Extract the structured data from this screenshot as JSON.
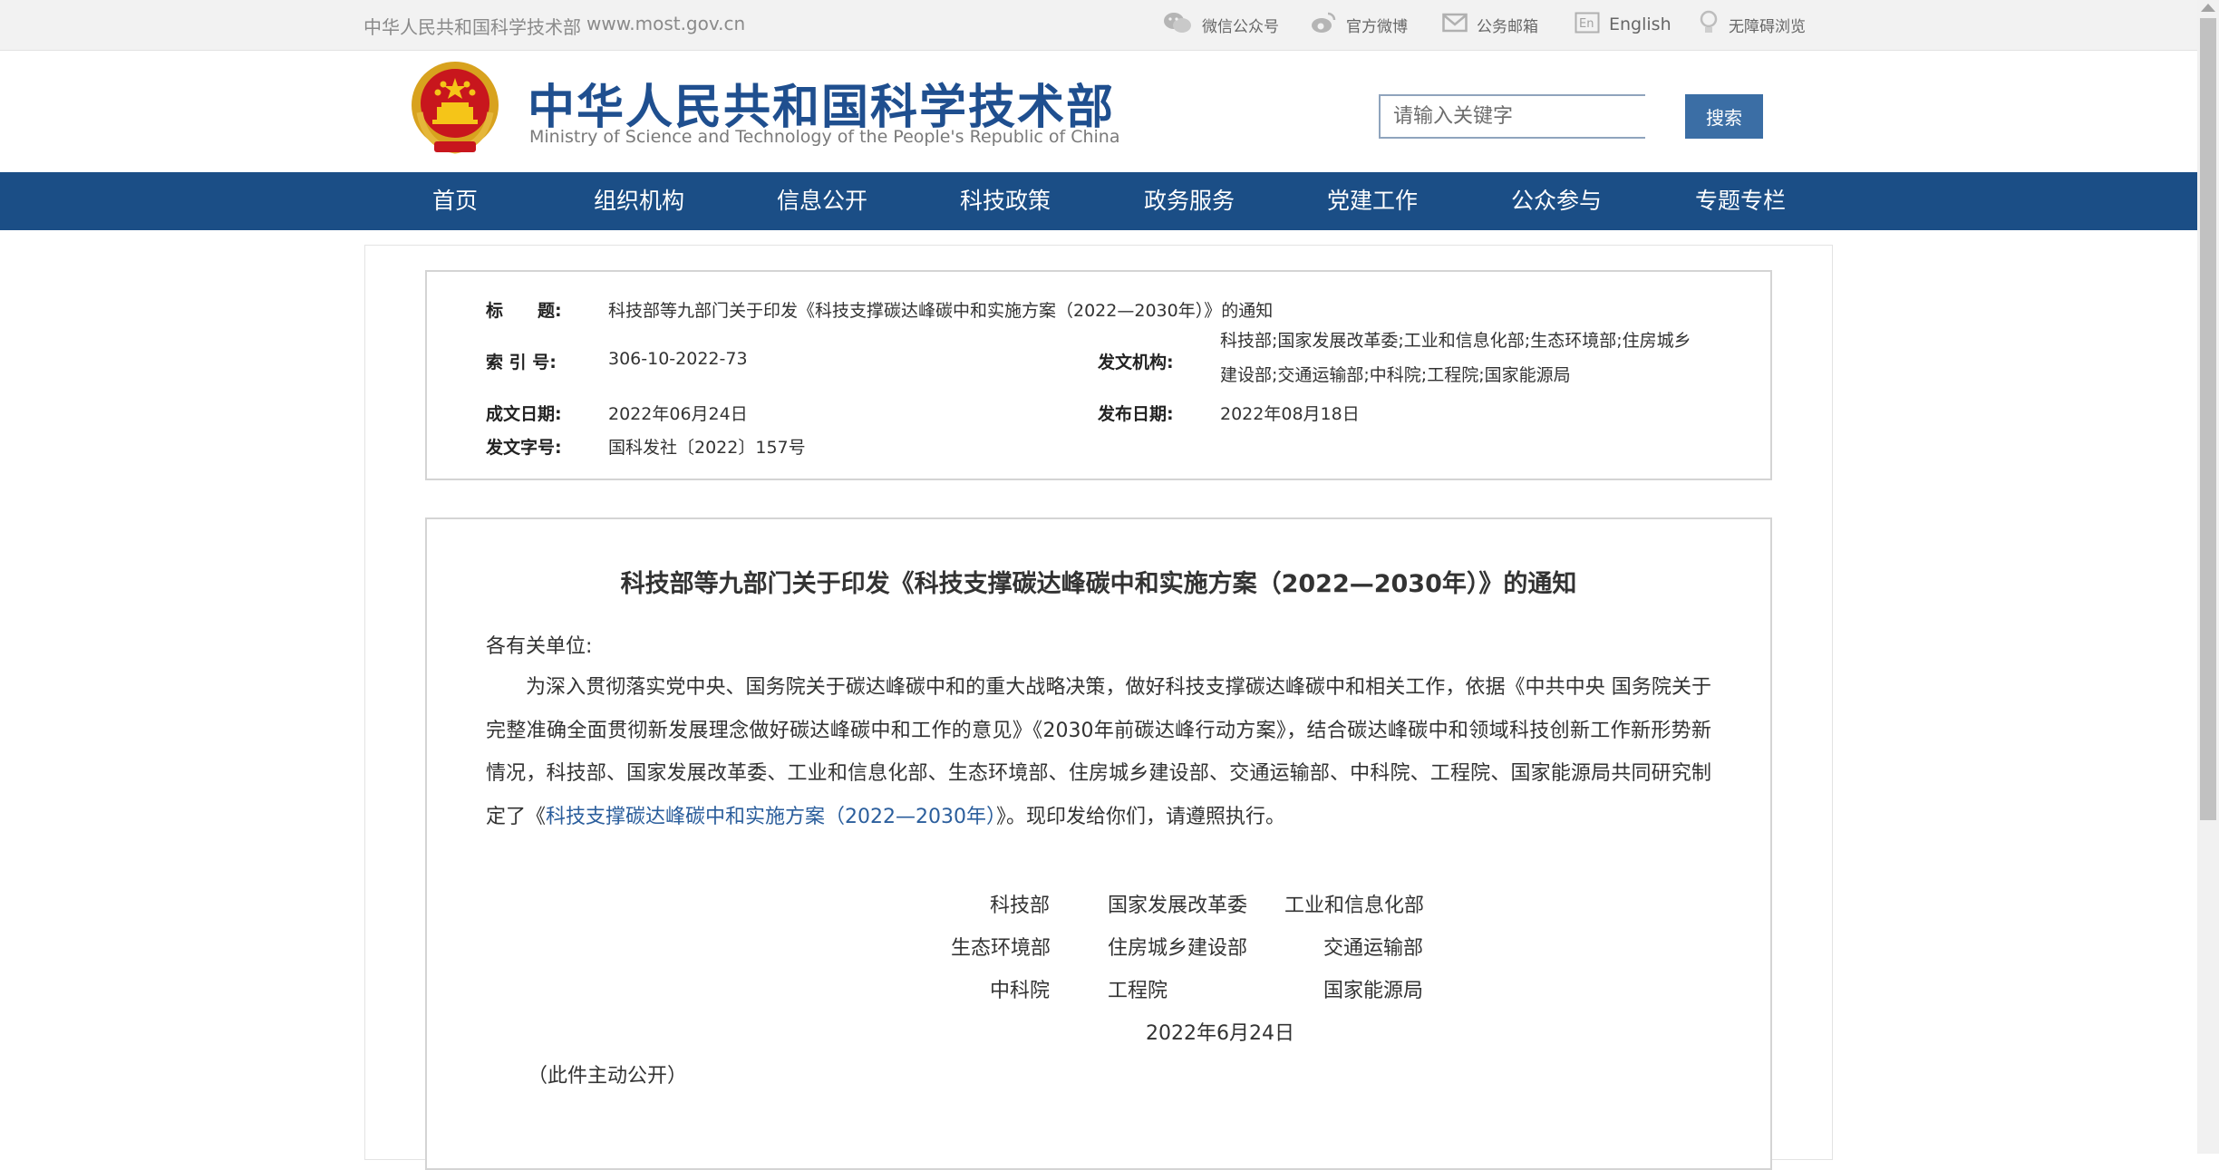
{
  "topbar": {
    "site_name": "中华人民共和国科学技术部",
    "site_url": "www.most.gov.cn",
    "links": [
      {
        "label": "微信公众号",
        "icon": "wechat-icon"
      },
      {
        "label": "官方微博",
        "icon": "weibo-icon"
      },
      {
        "label": "公务邮箱",
        "icon": "mail-icon"
      },
      {
        "label": "English",
        "icon": "english-icon"
      },
      {
        "label": "无障碍浏览",
        "icon": "accessibility-icon"
      }
    ]
  },
  "header": {
    "logo_cn": "中华人民共和国科学技术部",
    "logo_en": "Ministry of Science and Technology of the People's Republic of China",
    "search_placeholder": "请输入关键字",
    "search_button": "搜索"
  },
  "nav": {
    "items": [
      "首页",
      "组织机构",
      "信息公开",
      "科技政策",
      "政务服务",
      "党建工作",
      "公众参与",
      "专题专栏"
    ]
  },
  "meta": {
    "title_label": "标　　题:",
    "title_value": "科技部等九部门关于印发《科技支撑碳达峰碳中和实施方案（2022—2030年）》的通知",
    "index_label": "索 引 号:",
    "index_value": "306-10-2022-73",
    "issuer_label": "发文机构:",
    "issuer_value": "科技部;国家发展改革委;工业和信息化部;生态环境部;住房城乡建设部;交通运输部;中科院;工程院;国家能源局",
    "created_label": "成文日期:",
    "created_value": "2022年06月24日",
    "published_label": "发布日期:",
    "published_value": "2022年08月18日",
    "docno_label": "发文字号:",
    "docno_value": "国科发社〔2022〕157号"
  },
  "document": {
    "title": "科技部等九部门关于印发《科技支撑碳达峰碳中和实施方案（2022—2030年）》的通知",
    "salutation": "各有关单位:",
    "body_before_link": "为深入贯彻落实党中央、国务院关于碳达峰碳中和的重大战略决策，做好科技支撑碳达峰碳中和相关工作，依据《中共中央 国务院关于完整准确全面贯彻新发展理念做好碳达峰碳中和工作的意见》《2030年前碳达峰行动方案》，结合碳达峰碳中和领域科技创新工作新形势新情况，科技部、国家发展改革委、工业和信息化部、生态环境部、住房城乡建设部、交通运输部、中科院、工程院、国家能源局共同研究制定了《",
    "plan_link": "科技支撑碳达峰碳中和实施方案（2022—2030年）",
    "body_after_link": "》。现印发给你们，请遵照执行。",
    "signatories": [
      [
        "科技部",
        "国家发展改革委",
        "工业和信息化部"
      ],
      [
        "生态环境部",
        "住房城乡建设部",
        "交通运输部"
      ],
      [
        "中科院",
        "工程院",
        "国家能源局"
      ]
    ],
    "date": "2022年6月24日",
    "note": "（此件主动公开）"
  },
  "colors": {
    "nav_bg": "#1b4e86",
    "logo_text": "#1f4f8f",
    "search_button": "#3b6ea5",
    "link": "#2b5e9c"
  }
}
